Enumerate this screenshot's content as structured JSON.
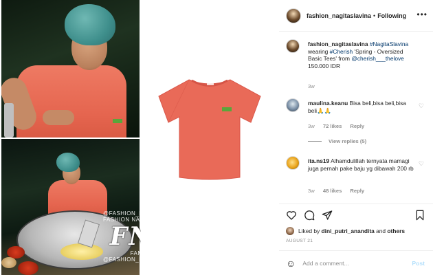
{
  "header": {
    "username": "fashion_nagitaslavina",
    "separator": "•",
    "follow_status": "Following",
    "more_icon": "more-horizontal-icon"
  },
  "media": {
    "watermark_top": "@FASHION_NAGITASLAVINA",
    "watermark_middle": "FASHION NAGITA SLAVINA",
    "watermark_logo": "FNS",
    "watermark_family": "FAMILY",
    "watermark_bottom": "@FASHION_NAGITASLAVINA"
  },
  "caption": {
    "username": "fashion_nagitaslavina",
    "mention1": "#NagitaSlavina",
    "text1": "wearing",
    "mention2": "#Cherish",
    "text2": "'Spring - Oversized Basic Tees' from",
    "mention3": "@cherish___thelove",
    "price": "150.000 IDR",
    "time": "3w"
  },
  "comments": [
    {
      "username": "maulina.keanu",
      "text": "Bisa beli,bisa beli,bisa beli🙏🙏",
      "time": "3w",
      "likes": "72 likes",
      "reply": "Reply",
      "view_replies": "View replies (5)"
    },
    {
      "username": "ita.ns19",
      "text": "Alhamdulillah ternyata mamagi juga pernah pake baju yg dibawah 200 rb",
      "time": "3w",
      "likes": "48 likes",
      "reply": "Reply"
    }
  ],
  "actions": {
    "liked_by_prefix": "Liked by",
    "liked_by_user": "dini_putri_anandita",
    "liked_by_and": "and",
    "liked_by_others": "others",
    "date": "AUGUST 21"
  },
  "add_comment": {
    "placeholder": "Add a comment...",
    "post_label": "Post"
  },
  "colors": {
    "link": "#00376b",
    "muted": "#8e8e8e",
    "post_disabled": "#b2dffc",
    "tshirt": "#e96a58"
  }
}
